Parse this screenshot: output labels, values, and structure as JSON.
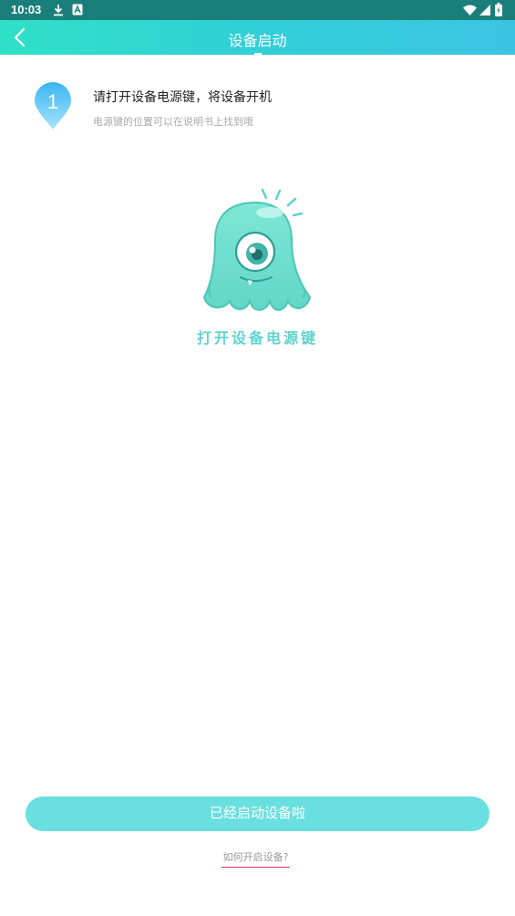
{
  "status_bar": {
    "time": "10:03",
    "left_icons": [
      "download-icon",
      "a-notification-icon"
    ],
    "right_icons": [
      "wifi-icon",
      "signal-icon",
      "battery-icon"
    ]
  },
  "header": {
    "title": "设备启动",
    "back_icon": "chevron-left-icon"
  },
  "step": {
    "number": "1",
    "title": "请打开设备电源键，将设备开机",
    "subtitle": "电源键的位置可以在说明书上找到哦"
  },
  "illustration": {
    "caption": "打开设备电源键"
  },
  "actions": {
    "primary_label": "已经启动设备啦",
    "help_link": "如何开启设备?"
  },
  "colors": {
    "status_bar": "#1a7f7a",
    "header_gradient_start": "#2fe0c6",
    "header_gradient_end": "#3bc4e1",
    "accent": "#6adfe0",
    "monster": "#6fdcc9",
    "caption": "#5fd3cf",
    "link_underline": "#e8364f"
  }
}
